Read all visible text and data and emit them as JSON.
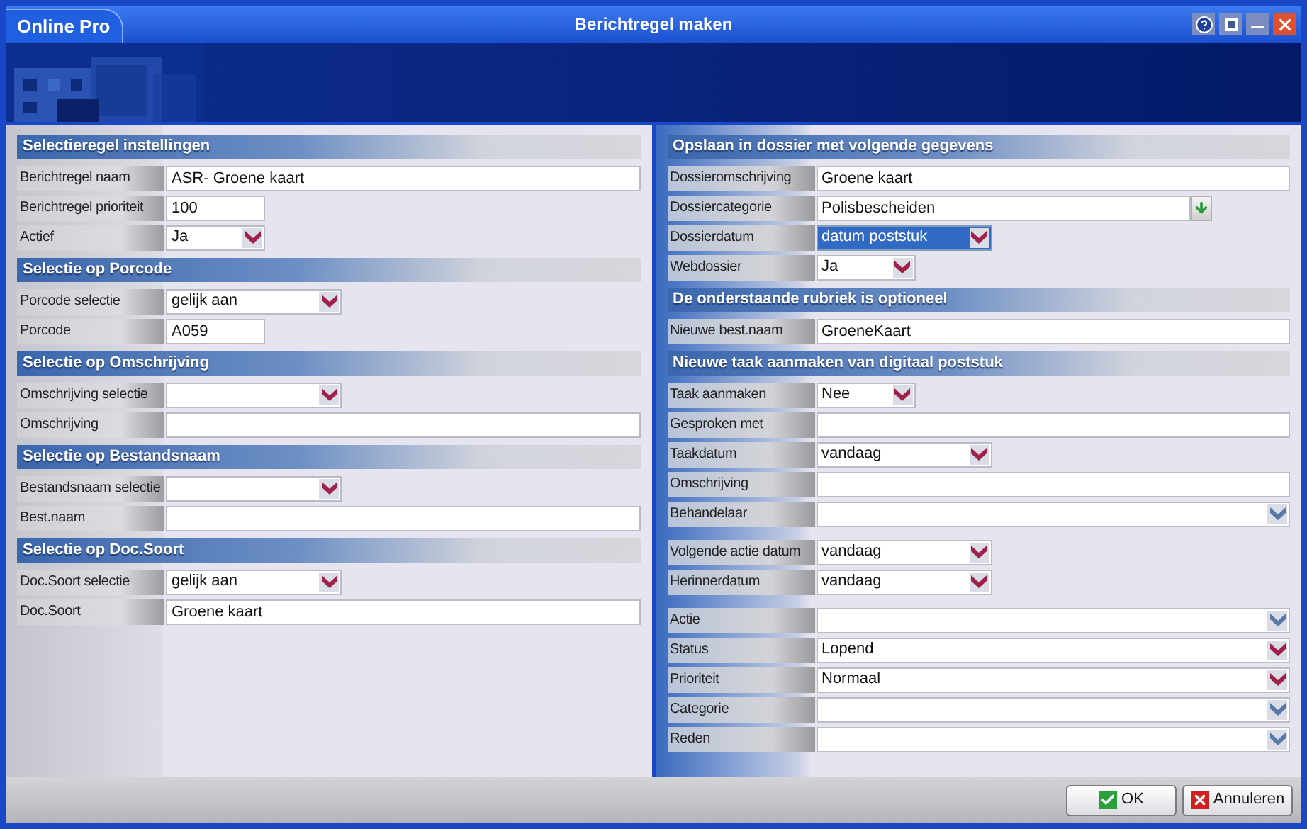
{
  "window": {
    "app_name": "Online Pro",
    "title": "Berichtregel maken"
  },
  "left_panel": [
    {
      "kind": "header",
      "label": "Selectieregel instellingen"
    },
    {
      "kind": "input",
      "label": "Berichtregel naam",
      "value": "ASR- Groene kaart"
    },
    {
      "kind": "short-input",
      "label": "Berichtregel prioriteit",
      "value": "100"
    },
    {
      "kind": "short-select",
      "label": "Actief",
      "value": "Ja",
      "color": "#a0204a",
      "focused": false
    },
    {
      "kind": "header",
      "label": "Selectie op Porcode"
    },
    {
      "kind": "select",
      "label": "Porcode selectie",
      "value": "gelijk aan",
      "color": "#a0204a",
      "focused": false
    },
    {
      "kind": "short-input",
      "label": "Porcode",
      "value": "A059"
    },
    {
      "kind": "header",
      "label": "Selectie op Omschrijving"
    },
    {
      "kind": "select",
      "label": "Omschrijving selectie",
      "color": "#a0204a",
      "focused": false
    },
    {
      "kind": "input",
      "label": "Omschrijving"
    },
    {
      "kind": "header",
      "label": "Selectie op Bestandsnaam"
    },
    {
      "kind": "select",
      "label": "Bestandsnaam selectie",
      "color": "#a0204a",
      "focused": false
    },
    {
      "kind": "input",
      "label": "Best.naam"
    },
    {
      "kind": "header",
      "label": "Selectie op Doc.Soort"
    },
    {
      "kind": "select",
      "label": "Doc.Soort selectie",
      "value": "gelijk aan",
      "color": "#a0204a",
      "focused": false
    },
    {
      "kind": "input",
      "label": "Doc.Soort",
      "value": "Groene kaart"
    }
  ],
  "right_panel": [
    {
      "kind": "header",
      "label": "Opslaan in dossier met volgende gegevens"
    },
    {
      "kind": "input",
      "label": "Dossieromschrijving",
      "value": "Groene kaart"
    },
    {
      "kind": "lookup",
      "label": "Dossiercategorie",
      "value": "Polisbescheiden"
    },
    {
      "kind": "select",
      "label": "Dossierdatum",
      "value": "datum poststuk",
      "color": "#a0204a",
      "focused": true
    },
    {
      "kind": "short-select",
      "label": "Webdossier",
      "value": "Ja",
      "color": "#a0204a",
      "focused": false
    },
    {
      "kind": "header",
      "label": "De onderstaande rubriek is optioneel"
    },
    {
      "kind": "input",
      "label": "Nieuwe best.naam",
      "value": "GroeneKaart"
    },
    {
      "kind": "header",
      "label": "Nieuwe taak aanmaken van digitaal poststuk"
    },
    {
      "kind": "short-select",
      "label": "Taak aanmaken",
      "value": "Nee",
      "color": "#a0204a",
      "focused": false
    },
    {
      "kind": "input",
      "label": "Gesproken met"
    },
    {
      "kind": "select",
      "label": "Taakdatum",
      "value": "vandaag",
      "color": "#a0204a",
      "focused": false
    },
    {
      "kind": "input",
      "label": "Omschrijving"
    },
    {
      "kind": "wide-select",
      "label": "Behandelaar",
      "color": "#5878a8",
      "focused": false
    },
    {
      "kind": "spacer"
    },
    {
      "kind": "select",
      "label": "Volgende actie datum",
      "value": "vandaag",
      "color": "#a0204a",
      "focused": false
    },
    {
      "kind": "select",
      "label": "Herinnerdatum",
      "value": "vandaag",
      "color": "#a0204a",
      "focused": false
    },
    {
      "kind": "spacer"
    },
    {
      "kind": "wide-select",
      "label": "Actie",
      "color": "#5878a8",
      "focused": false
    },
    {
      "kind": "wide-select",
      "label": "Status",
      "value": "Lopend",
      "color": "#a0204a",
      "focused": false
    },
    {
      "kind": "wide-select",
      "label": "Prioriteit",
      "value": "Normaal",
      "color": "#a0204a",
      "focused": false
    },
    {
      "kind": "wide-select",
      "label": "Categorie",
      "color": "#5878a8",
      "focused": false
    },
    {
      "kind": "wide-select",
      "label": "Reden",
      "color": "#5878a8",
      "focused": false
    }
  ],
  "buttons": [
    {
      "kind": "ok",
      "label": "OK"
    },
    {
      "kind": "cancel",
      "label": "Annuleren"
    }
  ]
}
